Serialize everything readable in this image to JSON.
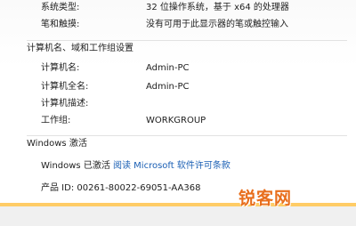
{
  "system": {
    "system_type_label": "系统类型:",
    "system_type_value": "32 位操作系统，基于 x64 的处理器",
    "pen_touch_label": "笔和触摸:",
    "pen_touch_value": "没有可用于此显示器的笔或触控输入"
  },
  "computer_section": {
    "title": "计算机名、域和工作组设置",
    "computer_name_label": "计算机名:",
    "computer_name_value": "Admin-PC",
    "full_name_label": "计算机全名:",
    "full_name_value": "Admin-PC",
    "description_label": "计算机描述:",
    "description_value": "",
    "workgroup_label": "工作组:",
    "workgroup_value": "WORKGROUP"
  },
  "activation_section": {
    "title": "Windows 激活",
    "status_text": "Windows 已激活",
    "license_link": "阅读 Microsoft 软件许可条款",
    "product_id": "产品 ID: 00261-80022-69051-AA368"
  },
  "watermark": "锐客网",
  "colors": {
    "link": "#1a5fb4",
    "watermark": "#e86e1c",
    "accent_bar": "#ffcc66"
  }
}
